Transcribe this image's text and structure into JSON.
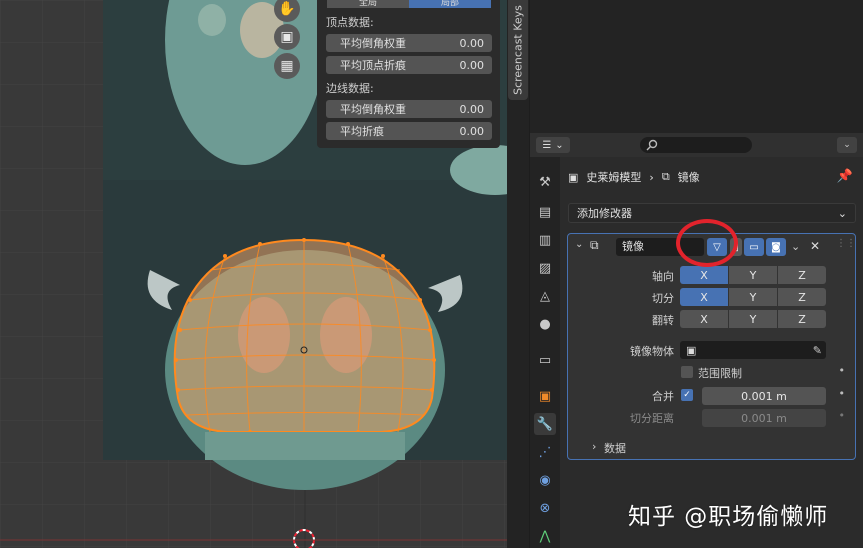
{
  "viewport": {
    "npanel": {
      "segment": [
        "全局",
        "局部"
      ],
      "vertex_section": "顶点数据:",
      "vertex_fields": [
        {
          "label": "平均倒角权重",
          "value": "0.00"
        },
        {
          "label": "平均顶点折痕",
          "value": "0.00"
        }
      ],
      "edge_section": "边线数据:",
      "edge_fields": [
        {
          "label": "平均倒角权重",
          "value": "0.00"
        },
        {
          "label": "平均折痕",
          "value": "0.00"
        }
      ]
    },
    "sidebar_tab": "Screencast Keys",
    "nav_icons": [
      "hand-icon",
      "camera-icon",
      "grid-icon"
    ]
  },
  "properties": {
    "object_name": "史莱姆模型",
    "modifier_breadcrumb": "镜像",
    "add_modifier_label": "添加修改器",
    "modifier": {
      "name": "镜像",
      "axis_label": "轴向",
      "bisect_label": "切分",
      "flip_label": "翻转",
      "axes": [
        "X",
        "Y",
        "Z"
      ],
      "axis_active": "X",
      "bisect_active": "X",
      "mirror_object_label": "镜像物体",
      "clipping_label": "范围限制",
      "merge_label": "合并",
      "merge_value": "0.001 m",
      "bisect_distance_label": "切分距离",
      "bisect_distance_value": "0.001 m",
      "data_section": "数据"
    }
  },
  "watermark": "知乎 @职场偷懒师",
  "colors": {
    "accent": "#4772b3",
    "highlight_ring": "#e2232c",
    "mesh": "#ff8a1f"
  }
}
